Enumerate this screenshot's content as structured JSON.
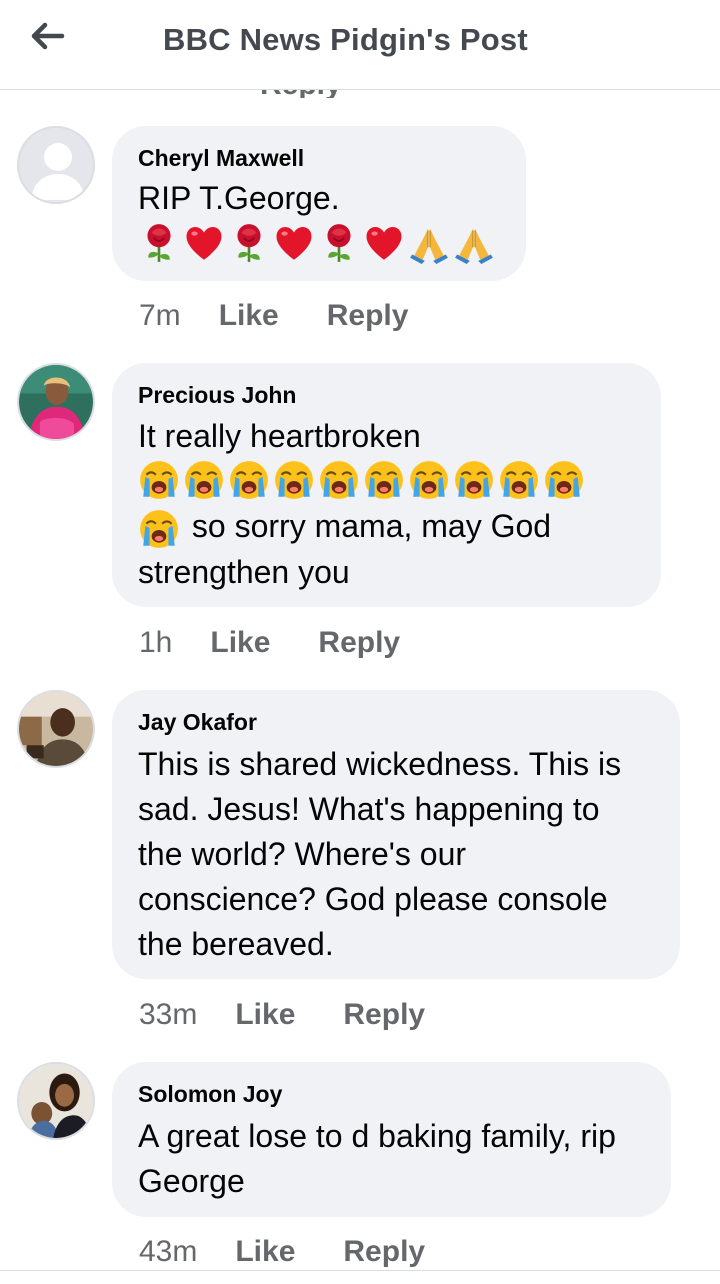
{
  "header": {
    "title": "BBC News Pidgin's Post",
    "back_icon": "back-arrow-icon"
  },
  "clipped_prev": {
    "reply_label": "Reply"
  },
  "comments": [
    {
      "author": "Cheryl Maxwell",
      "text": "RIP T.George.",
      "emoji": [
        "rose",
        "heart",
        "rose",
        "heart",
        "rose",
        "heart",
        "folded-hands",
        "folded-hands"
      ],
      "time": "7m",
      "like_label": "Like",
      "reply_label": "Reply"
    },
    {
      "author": "Precious John",
      "text": "It really heartbroken",
      "emoji": [
        "loudly-crying-face",
        "loudly-crying-face",
        "loudly-crying-face",
        "loudly-crying-face",
        "loudly-crying-face",
        "loudly-crying-face",
        "loudly-crying-face",
        "loudly-crying-face",
        "loudly-crying-face",
        "loudly-crying-face",
        "loudly-crying-face"
      ],
      "text_after_emoji_line1": "so sorry mama, may God",
      "text_after_emoji_line2": "strengthen you",
      "time": "1h",
      "like_label": "Like",
      "reply_label": "Reply"
    },
    {
      "author": "Jay Okafor",
      "lines": [
        "This is shared wickedness. This is",
        "sad. Jesus! What's happening to",
        "the world? Where's our",
        "conscience? God please console",
        "the bereaved."
      ],
      "time": "33m",
      "like_label": "Like",
      "reply_label": "Reply"
    },
    {
      "author": "Solomon Joy",
      "lines": [
        "A great lose to d baking family, rip",
        "George"
      ],
      "time": "43m",
      "like_label": "Like",
      "reply_label": "Reply"
    }
  ],
  "colors": {
    "bubble": "#f0f2f5",
    "secondary_text": "#65676b",
    "header_text": "#444950"
  }
}
